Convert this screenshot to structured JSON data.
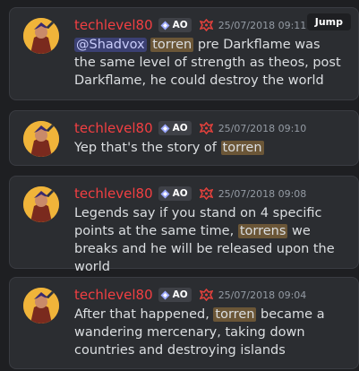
{
  "jump_label": "Jump",
  "messages": [
    {
      "username": "techlevel80",
      "tag": "AO",
      "timestamp": "25/07/2018 09:11",
      "mention": "@Shadvox",
      "highlight": "torren",
      "text_rest": " pre Darkflame was the same level of strength as theos, post Darkflame, he could destroy the world"
    },
    {
      "username": "techlevel80",
      "tag": "AO",
      "timestamp": "25/07/2018 09:10",
      "text_before": "Yep that's the story of ",
      "highlight": "torren",
      "text_after": ""
    },
    {
      "username": "techlevel80",
      "tag": "AO",
      "timestamp": "25/07/2018 09:08",
      "text_before": "Legends say if you stand on 4 specific points at the same time, ",
      "highlight": "torrens",
      "text_after": " we breaks and he will be released upon the world"
    },
    {
      "username": "techlevel80",
      "tag": "AO",
      "timestamp": "25/07/2018 09:04",
      "text_before": "After that happened, ",
      "highlight": "torren",
      "text_after": " became a wandering mercenary, taking down countries and destroying islands"
    }
  ]
}
